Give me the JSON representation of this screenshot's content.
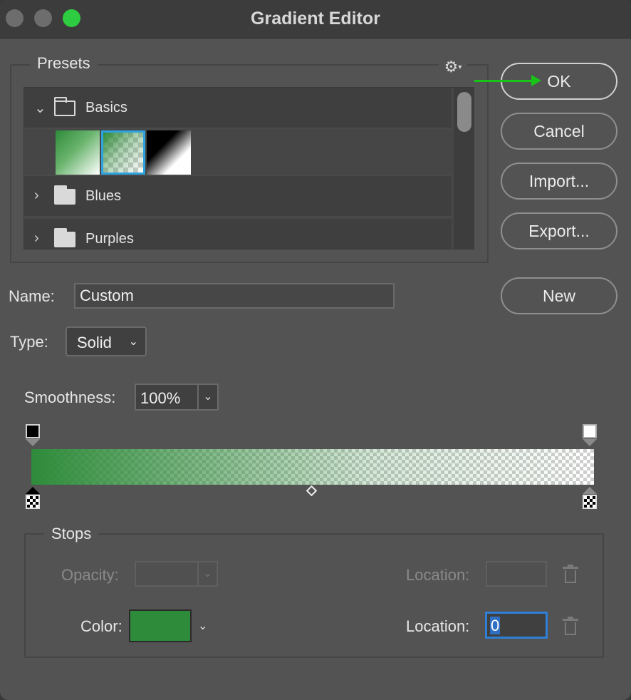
{
  "window": {
    "title": "Gradient Editor"
  },
  "presets": {
    "label": "Presets",
    "settings_icon": "gear-icon",
    "folders": [
      {
        "label": "Basics",
        "expanded": true
      },
      {
        "label": "Blues",
        "expanded": false
      },
      {
        "label": "Purples",
        "expanded": false
      }
    ],
    "thumbnails": [
      {
        "name": "green-to-white",
        "selected": false
      },
      {
        "name": "green-to-transparent",
        "selected": true
      },
      {
        "name": "black-to-white",
        "selected": false
      }
    ]
  },
  "buttons": {
    "ok": "OK",
    "cancel": "Cancel",
    "import": "Import...",
    "export": "Export...",
    "new": "New"
  },
  "form": {
    "name_label": "Name:",
    "name_value": "Custom",
    "type_label": "Type:",
    "type_value": "Solid",
    "smoothness_label": "Smoothness:",
    "smoothness_value": "100%"
  },
  "stops": {
    "label": "Stops",
    "opacity_label": "Opacity:",
    "opacity_location_label": "Location:",
    "color_label": "Color:",
    "color_value": "#2e8b3a",
    "color_location_label": "Location:",
    "color_location_value": "0"
  },
  "colors": {
    "accent_green": "#18c418",
    "selection_blue": "#2ea3e0",
    "gradient_start": "#2e8b3a"
  }
}
